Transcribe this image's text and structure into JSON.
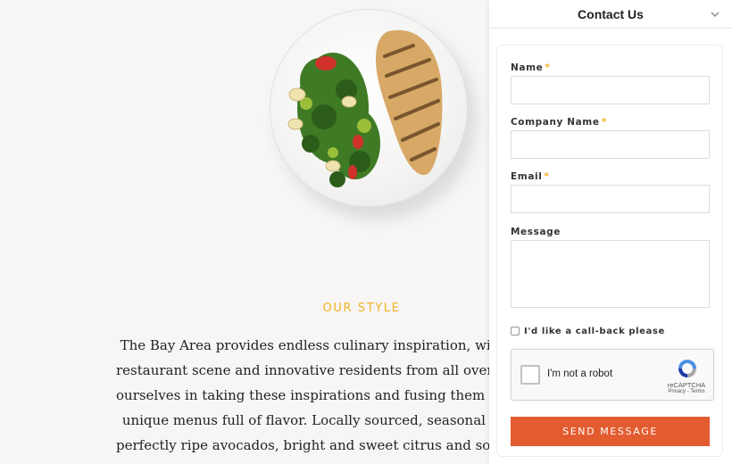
{
  "section": {
    "title": "OUR STYLE",
    "body_lines": [
      "The Bay Area provides endless culinary inspiration, with",
      "restaurant scene and innovative residents from all over the",
      "ourselves in taking these inspirations and fusing them tog",
      "unique menus full of flavor. Locally sourced, seasonal in",
      "perfectly ripe avocados, bright and sweet citrus and so muc"
    ]
  },
  "contact_panel": {
    "title": "Contact Us",
    "chevron_icon": "chevron-down-icon",
    "fields": {
      "name_label": "Name",
      "company_label": "Company Name",
      "email_label": "Email",
      "message_label": "Message",
      "required_mark": "*"
    },
    "callback_label": "I'd like a call-back please",
    "recaptcha": {
      "label": "I'm not a robot",
      "brand": "reCAPTCHA",
      "links": "Privacy - Terms"
    },
    "submit_label": "SEND MESSAGE"
  },
  "colors": {
    "accent": "#f0b323",
    "button": "#e35c2f",
    "background": "#f8f6f4"
  }
}
